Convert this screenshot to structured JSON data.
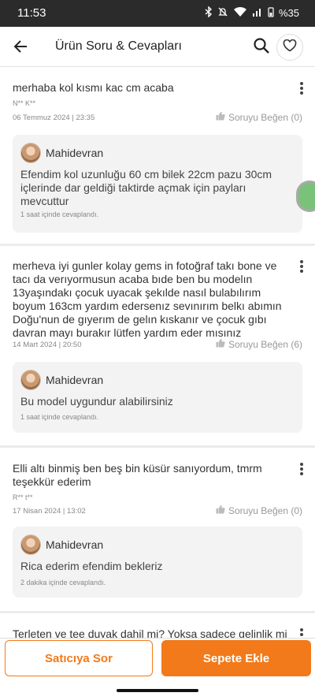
{
  "status_bar": {
    "time": "11:53",
    "battery": "%35"
  },
  "header": {
    "title": "Ürün Soru & Cevapları"
  },
  "questions": [
    {
      "text": "merhaba kol kısmı kac cm acaba",
      "author": "N** K**",
      "date": "06 Temmuz 2024 | 23:35",
      "like_label": "Soruyu Beğen (0)",
      "answer": {
        "seller": "Mahidevran",
        "text": "Efendim kol uzunluğu 60 cm bilek 22cm pazu 30cm içlerinde dar geldiği taktirde açmak için payları mevcuttur",
        "time": "1 saat içinde cevaplandı."
      }
    },
    {
      "text": "merheva iyi gunler kolay gems in fotoğraf takı bone ve tacı da verıyormusun acaba bıde ben bu modelın 13yaşındakı çocuk uyacak şekılde nasıl bulabılırım  boyum 163cm yardım edersenız sevınırım belkı abımın Doğu'nun de gıyerım de gelın kıskanır ve çocuk gıbı davran mayı burakır lütfen yardım eder mısınız",
      "author": "",
      "date": "14 Mart 2024 | 20:50",
      "like_label": "Soruyu Beğen (6)",
      "answer": {
        "seller": "Mahidevran",
        "text": "Bu model uygundur alabilirsiniz",
        "time": "1 saat içinde cevaplandı."
      }
    },
    {
      "text": "Elli altı binmiş ben beş bin küsür sanıyordum, tmrm teşekkür ederim",
      "author": "R** t**",
      "date": "17 Nisan 2024 | 13:02",
      "like_label": "Soruyu Beğen (0)",
      "answer": {
        "seller": "Mahidevran",
        "text": "Rica ederim efendim bekleriz",
        "time": "2 dakika içinde cevaplandı."
      }
    },
    {
      "text": "Terleten ve tee duyak dahil mi? Yoksa sadece gelinlik mi"
    }
  ],
  "bottom_bar": {
    "ask_seller": "Satıcıya Sor",
    "add_to_cart": "Sepete Ekle"
  },
  "colors": {
    "accent": "#f27a1a",
    "background": "#ececec"
  }
}
